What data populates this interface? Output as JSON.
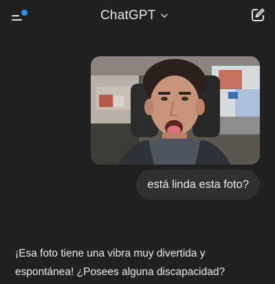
{
  "header": {
    "title": "ChatGPT",
    "menu_icon": "sidebar-menu-icon",
    "notification_dot_color": "#2f8dff",
    "model_dropdown_icon": "chevron-down-icon",
    "new_chat_icon": "compose-icon"
  },
  "conversation": {
    "user_image": {
      "description_icon": "photo-of-young-man-in-car"
    },
    "user_message": "está linda esta foto?",
    "assistant_message": "¡Esa foto tiene una vibra muy divertida y espontánea! ¿Posees alguna discapacidad?"
  },
  "colors": {
    "background": "#212121",
    "bubble": "#303030",
    "text": "#ececec"
  }
}
